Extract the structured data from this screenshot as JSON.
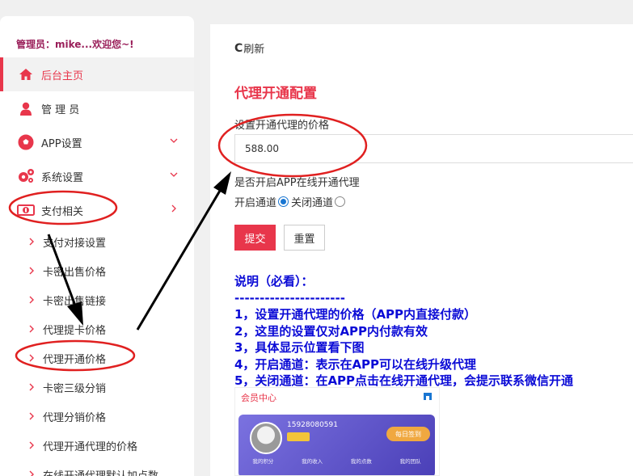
{
  "admin": {
    "label": "管理员：",
    "name": "mike...",
    "welcome": "欢迎您~!"
  },
  "menu": {
    "items": [
      {
        "label": "后台主页",
        "icon": "home-icon",
        "active": true
      },
      {
        "label": "管 理 员",
        "icon": "user-icon"
      },
      {
        "label": "APP设置",
        "icon": "soccer-ball-icon",
        "arrow": "chevron-down-icon"
      },
      {
        "label": "系统设置",
        "icon": "gears-icon",
        "arrow": "chevron-down-icon"
      },
      {
        "label": "支付相关",
        "icon": "money-icon",
        "arrow": "chevron-right-icon"
      }
    ],
    "subitems": [
      {
        "label": "支付对接设置"
      },
      {
        "label": "卡密出售价格"
      },
      {
        "label": "卡密出售链接"
      },
      {
        "label": "代理提卡价格"
      },
      {
        "label": "代理开通价格"
      },
      {
        "label": "卡密三级分销"
      },
      {
        "label": "代理分销价格"
      },
      {
        "label": "代理开通代理的价格"
      },
      {
        "label": "在线开通代理默认加点数"
      }
    ]
  },
  "toolbar": {
    "refresh_label": "刷新"
  },
  "form": {
    "title": "代理开通配置",
    "price_label": "设置开通代理的价格",
    "price_value": "588.00",
    "online_label": "是否开启APP在线开通代理",
    "open_label": "开启通道",
    "close_label": "关闭通道",
    "selected": "open",
    "submit_label": "提交",
    "reset_label": "重置"
  },
  "notes": {
    "lines": [
      "说明（必看）：",
      "----------------------",
      "1，设置开通代理的价格（APP内直接付款）",
      "2，这里的设置仅对APP内付款有效",
      "3，具体显示位置看下图",
      "4，开启通道：表示在APP可以在线升级代理",
      "5，关闭通道：在APP点击在线开通代理，会提示联系微信开通"
    ]
  },
  "screenshot": {
    "title": "会员中心",
    "phone": "15928080591",
    "checkin": "每日签到",
    "stats": [
      "我的积分",
      "我的收入",
      "我的点数",
      "我的团队"
    ]
  },
  "colors": {
    "accent": "#e8364b",
    "note_blue": "#0a0ad6",
    "annotation_red": "#e02020"
  }
}
